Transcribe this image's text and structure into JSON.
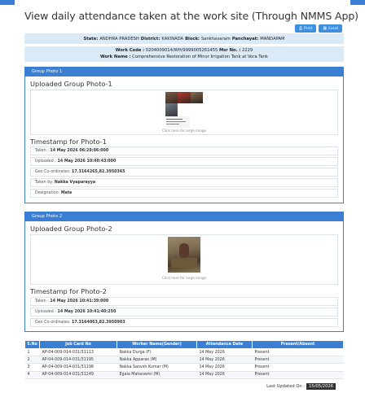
{
  "corner_text": "...",
  "title": "View daily attendance taken at the work site (Through NMMS App)",
  "buttons": {
    "print": "Print",
    "excel": "Excel"
  },
  "location": {
    "state_label": "State:",
    "state": "ANDHRA PRADESH",
    "district_label": "District:",
    "district": "KAKINADA",
    "block_label": "Block:",
    "block": "Sankhavaram",
    "panchayat_label": "Panchayat:",
    "panchayat": "MANDAPAM"
  },
  "work": {
    "code_label": "Work Code :",
    "code": "0204009014/WH/9999005261455",
    "muster_label": "Msr No. :",
    "muster": "2229",
    "name_label": "Work Name :",
    "name": "Comprehensive Restoration of Minor Irrigation Tank at Vora Tank"
  },
  "group1": {
    "panel_title": "Group Photo 1",
    "heading": "Uploaded Group Photo-1",
    "click_text": "Click here for large image",
    "ts_heading": "Timestamp for Photo-1",
    "taken_label": "Taken :",
    "taken": "14 May 2026 06:29:06:000",
    "uploaded_label": "Uploaded :",
    "uploaded": "14 May 2026 10:40:43:000",
    "geo_label": "Geo Co-ordinates:",
    "geo": "17.3164265,82.3950365",
    "taken_by_label": "Taken by:",
    "taken_by": "Nakka Vyaparayya",
    "designation_label": "Designation:",
    "designation": "Mate"
  },
  "group2": {
    "panel_title": "Group Photo 2",
    "heading": "Uploaded Group Photo-2",
    "click_text": "Click here for large image",
    "ts_heading": "Timestamp for Photo-2",
    "taken_label": "Taken :",
    "taken": "14 May 2026 10:41:39:000",
    "uploaded_label": "Uploaded :",
    "uploaded": "14 May 2026 10:41:40:250",
    "geo_label": "Geo Co-ordinates:",
    "geo": "17.3164063,82.3950903"
  },
  "table": {
    "headers": [
      "S.No",
      "Job Card No",
      "Worker Name(Gender)",
      "Attendance Date",
      "Present/Absent"
    ],
    "rows": [
      [
        "1",
        "AP-04-009-014-031/31113",
        "Nakka Durga (F)",
        "14 May 2026",
        "Present"
      ],
      [
        "2",
        "AP-04-009-014-031/31195",
        "Nakka Apparao (M)",
        "14 May 2026",
        "Present"
      ],
      [
        "3",
        "AP-04-009-014-031/31198",
        "Nakka Sanvsh Kumar (M)",
        "14 May 2026",
        "Present"
      ],
      [
        "4",
        "AP-04-009-014-031/31249",
        "Egala Maheswmi (M)",
        "14 May 2026",
        "Present"
      ]
    ]
  },
  "last_updated_label": "Last Updated On :",
  "last_updated": "15/05/2026",
  "colors": {
    "accent": "#3b7fd4",
    "info_bg": "#dbeaf7"
  },
  "icons": {
    "print": "printer-icon",
    "excel": "spreadsheet-icon"
  }
}
